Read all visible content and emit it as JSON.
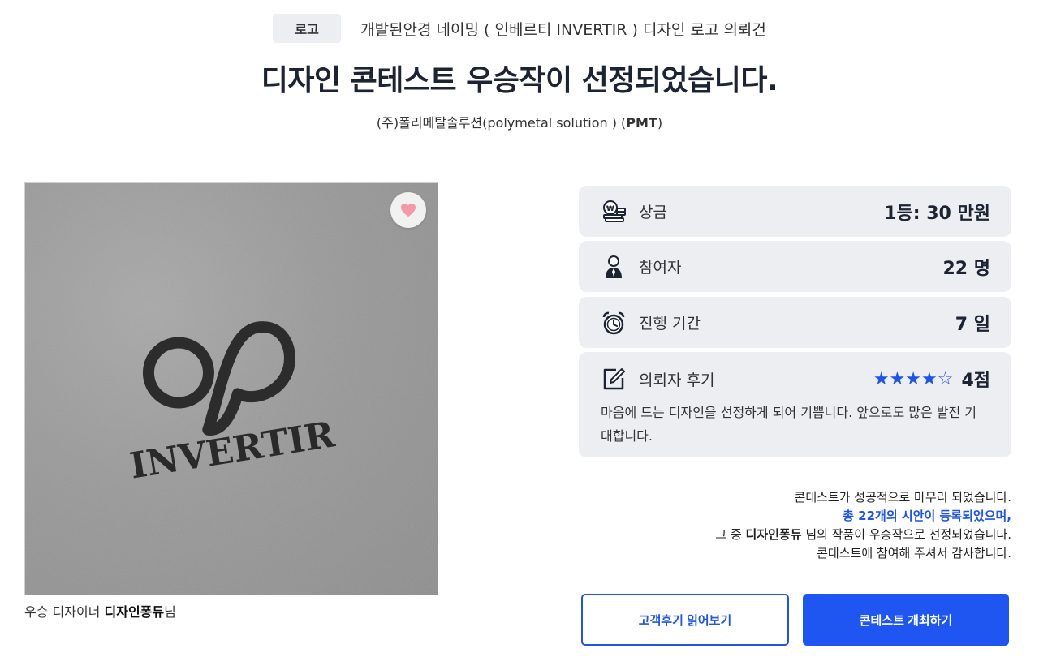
{
  "header": {
    "category": "로고",
    "contest_name": "개발된안경 네이밍 ( 인베르티 INVERTIR ) 디자인 로고 의뢰건"
  },
  "title": "디자인 콘테스트 우승작이 선정되었습니다.",
  "company": {
    "name": "(주)폴리메탈솔루션(polymetal solution ) (",
    "abbr": "PMT",
    "close": ")"
  },
  "winner": {
    "logo_text": "INVERTIR",
    "caption_prefix": "우승 디자이너 ",
    "designer": "디자인퐁듀",
    "caption_suffix": "님"
  },
  "stats": {
    "prize": {
      "label": "상금",
      "value": "1등: 30 만원",
      "icon": "money-icon"
    },
    "participants": {
      "label": "참여자",
      "value": "22 명",
      "icon": "person-icon"
    },
    "duration": {
      "label": "진행 기간",
      "value": "7 일",
      "icon": "clock-icon"
    }
  },
  "review": {
    "label": "의뢰자 후기",
    "stars": "★★★★☆",
    "rating": 4,
    "score": "4점",
    "text": "마음에 드는 디자인을 선정하게 되어 기쁩니다. 앞으로도 많은 발전 기대합니다."
  },
  "summary": {
    "line1": "콘테스트가 성공적으로 마무리 되었습니다.",
    "line2": "총 22개의 시안이 등록되었으며,",
    "line3_prefix": "그 중 ",
    "line3_designer": "디자인퐁듀",
    "line3_suffix": " 님의 작품이 우승작으로 선정되었습니다.",
    "line4": "콘테스트에 참여해 주셔서 감사합니다."
  },
  "buttons": {
    "reviews": "고객후기 읽어보기",
    "host": "콘테스트 개최하기"
  },
  "colors": {
    "accent": "#1f55e0",
    "card_bg": "#eceef1",
    "heart": "#f29aa6"
  }
}
